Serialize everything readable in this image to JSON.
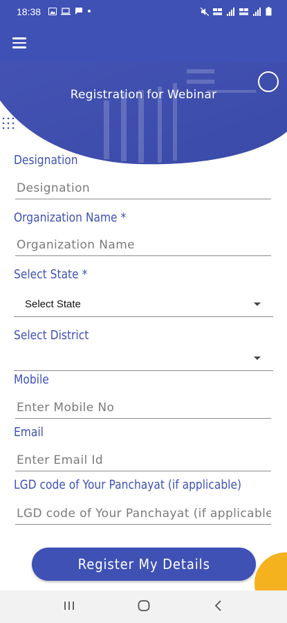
{
  "status_bar": {
    "time": "18:38",
    "left_icons": [
      "image-icon",
      "laptop-icon",
      "message-icon",
      "dot-icon"
    ],
    "right_icons": [
      "mute-icon",
      "volte-icon",
      "signal-icon",
      "volte-icon",
      "signal-icon",
      "battery-icon"
    ]
  },
  "app_bar": {
    "menu_icon": "hamburger-menu-icon"
  },
  "banner": {
    "title": "Registration for Webinar"
  },
  "form": {
    "designation": {
      "label": "Designation",
      "placeholder": "Designation"
    },
    "organization": {
      "label": "Organization Name *",
      "placeholder": "Organization Name"
    },
    "state": {
      "label": "Select State *",
      "value": "Select State"
    },
    "district": {
      "label": "Select District",
      "value": ""
    },
    "mobile": {
      "label": "Mobile",
      "placeholder": "Enter Mobile No"
    },
    "email": {
      "label": "Email",
      "placeholder": "Enter Email Id"
    },
    "lgd": {
      "label": "LGD code of Your Panchayat (if applicable)",
      "placeholder": "LGD code of Your Panchayat (if applicable"
    }
  },
  "register_button": {
    "label": "Register My Details"
  },
  "colors": {
    "primary": "#3f51b5",
    "accent": "#f5b21f",
    "nav_bg": "#f2f2f2"
  },
  "nav_bar": {
    "icons": [
      "recent-apps-icon",
      "home-icon",
      "back-icon"
    ]
  }
}
